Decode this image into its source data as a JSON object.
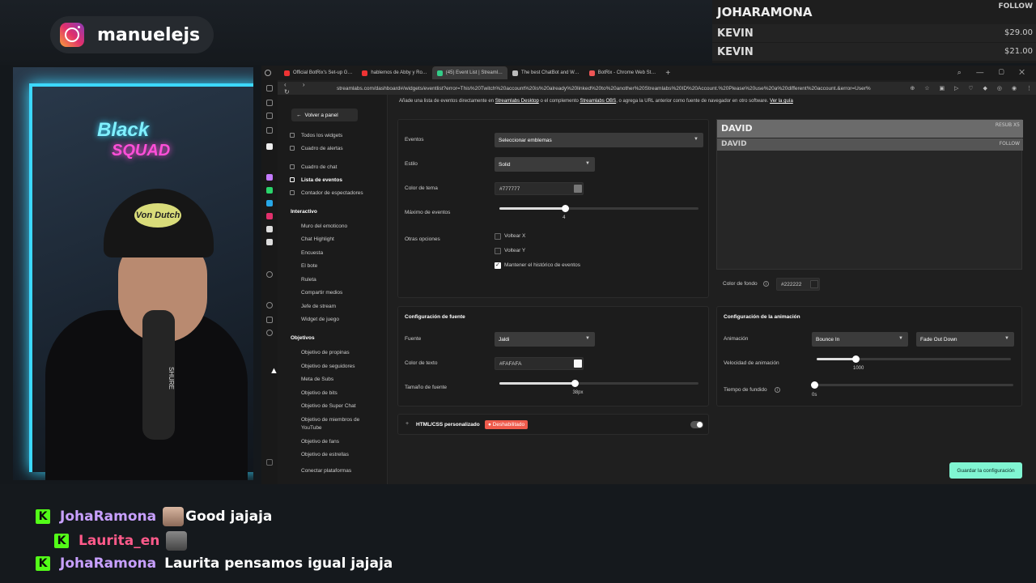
{
  "instagram": {
    "handle": "manuelejs"
  },
  "overlay": {
    "follow_name": "JOHARAMONA",
    "follow_badge": "FOLLOW",
    "rows": [
      {
        "name": "KEVIN",
        "value": "$29.00"
      },
      {
        "name": "KEVIN",
        "value": "$21.00"
      }
    ]
  },
  "webcam": {
    "sign_line1": "Black",
    "sign_line2": "SQUAD",
    "cap_text": "Von Dutch",
    "mic_brand": "SHURE"
  },
  "browser": {
    "tabs": [
      {
        "label": "Official BotRix's Set-up G…",
        "color": "#e33"
      },
      {
        "label": "hablemos de Abby y Ro…",
        "color": "#e33"
      },
      {
        "label": "(45) Event List | Streaml…",
        "color": "#3c8",
        "active": true
      },
      {
        "label": "The best ChatBot and W…",
        "color": "#bbb"
      },
      {
        "label": "BotRix - Chrome Web St…",
        "color": "#e55"
      }
    ],
    "tab_plus": "+",
    "window_controls": "⌕ — ▢ ✕",
    "nav_buttons": "‹ › ↻",
    "url": "streamlabs.com/dashboard#/widgets/eventlist?error=This%20Twitch%20account%20is%20already%20linked%20to%20another%20Streamlabs%20ID%20Account.%20Please%20use%20a%20different%20account.&error=User%",
    "ext_icons": "⊕ ☆ ▣ ▷ ♡ ◆ ◎ ◉ ⋮"
  },
  "sidebar": {
    "back_label": "Volver a panel",
    "items": [
      {
        "label": "Todos los widgets"
      },
      {
        "label": "Cuadro de alertas"
      },
      {
        "label": "Cuadro de chat"
      },
      {
        "label": "Lista de eventos",
        "active": true
      },
      {
        "label": "Contador de espectadores"
      }
    ],
    "section_interactive": "Interactivo",
    "interactive_items": [
      {
        "label": "Muro del emoticono"
      },
      {
        "label": "Chat Highlight"
      },
      {
        "label": "Encuesta"
      },
      {
        "label": "El bote"
      },
      {
        "label": "Ruleta"
      },
      {
        "label": "Compartir medios"
      },
      {
        "label": "Jefe de stream"
      },
      {
        "label": "Widget de juego"
      }
    ],
    "section_goals": "Objetivos",
    "goal_items": [
      {
        "label": "Objetivo de propinas"
      },
      {
        "label": "Objetivo de seguidores"
      },
      {
        "label": "Meta de Subs"
      },
      {
        "label": "Objetivo de bits"
      },
      {
        "label": "Objetivo de Super Chat"
      },
      {
        "label": "Objetivo de miembros de"
      },
      {
        "label": "YouTube"
      },
      {
        "label": "Objetivo de fans"
      },
      {
        "label": "Objetivo de estrellas"
      },
      {
        "label": "Conectar plataformas"
      }
    ]
  },
  "notice": {
    "text1": "Añade una lista de eventos directamente en",
    "link1": "Streamlabs Desktop",
    "text2": "o el complemento",
    "link2": "Streamlabs OBS",
    "text3": ", o agrega la URL anterior como fuente de navegador en otro software.",
    "link3": "Ver la guía"
  },
  "settings": {
    "events_label": "Eventos",
    "events_value": "Seleccionar emblemas",
    "style_label": "Estilo",
    "style_value": "Solid",
    "theme_color_label": "Color de tema",
    "theme_color_value": "#777777",
    "max_events_label": "Máximo de eventos",
    "max_events_value": "4",
    "max_events_fraction": 0.33,
    "other_options_label": "Otras opciones",
    "flip_x": "Voltear X",
    "flip_y": "Voltear Y",
    "keep_history": "Mantener el histórico de eventos"
  },
  "preview": {
    "rows": [
      {
        "name": "DAVID",
        "badge": "RESUB X5"
      },
      {
        "name": "DAVID",
        "badge": "FOLLOW"
      }
    ],
    "bg_color_label": "Color de fondo",
    "bg_color_value": "#222222"
  },
  "font_config": {
    "title": "Configuración de fuente",
    "font_label": "Fuente",
    "font_value": "Jaldi",
    "text_color_label": "Color de texto",
    "text_color_value": "#FAFAFA",
    "size_label": "Tamaño de fuente",
    "size_value": "38px",
    "size_fraction": 0.38
  },
  "animation_config": {
    "title": "Configuración de la animación",
    "animation_label": "Animación",
    "in_value": "Bounce In",
    "out_value": "Fade Out Down",
    "speed_label": "Velocidad de animación",
    "speed_value": "1000",
    "speed_fraction": 0.2,
    "fade_label": "Tiempo de fundido",
    "fade_value": "0s",
    "fade_fraction": 0.0
  },
  "custom_html": {
    "label": "HTML/CSS personalizado",
    "status": "● Deshabilitado"
  },
  "save_button": "Guardar la configuración",
  "chat": [
    {
      "user": "JohaRamona",
      "user_color": "#c8a0ff",
      "text": "Good jajaja",
      "emote": true
    },
    {
      "user": "Laurita_en",
      "user_color": "#ff5a8a",
      "text": "",
      "emote": true
    },
    {
      "user": "JohaRamona",
      "user_color": "#c8a0ff",
      "text": "Laurita pensamos igual jajaja",
      "emote": false
    }
  ],
  "colors": {
    "accent": "#80f5d2",
    "kick": "#53fc18",
    "disabled": "#ef5b4c"
  }
}
